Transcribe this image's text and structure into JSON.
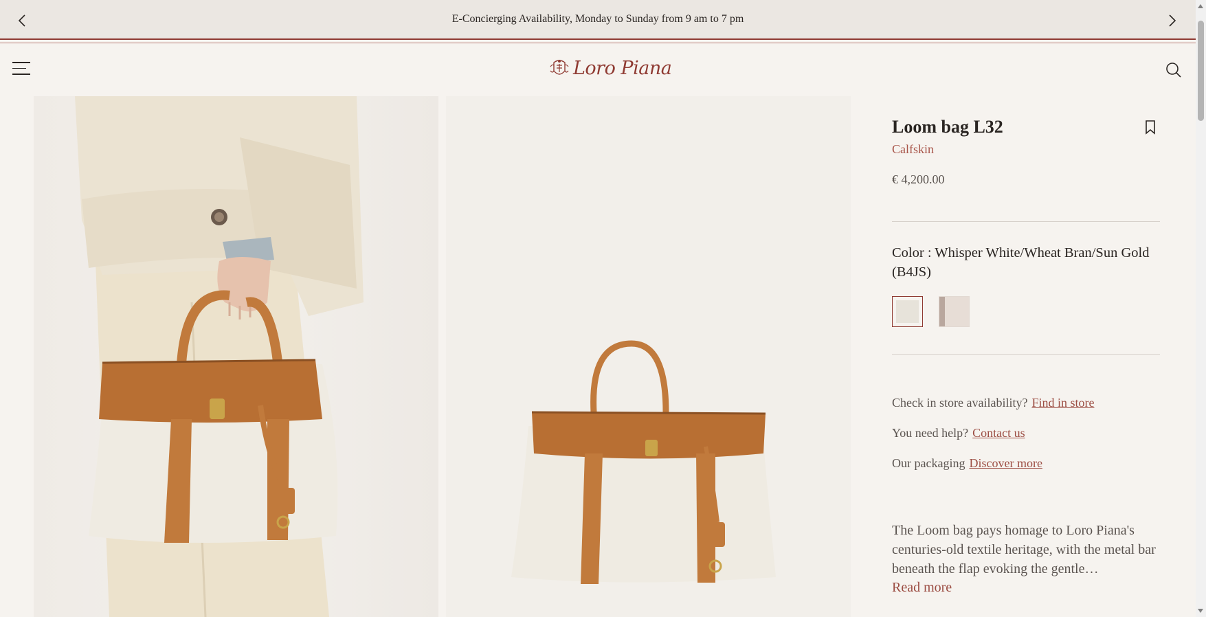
{
  "announcement": {
    "text": "E-Concierging Availability, Monday to Sunday from 9 am to 7 pm",
    "prev_icon": "chevron-left-icon",
    "next_icon": "chevron-right-icon"
  },
  "header": {
    "menu_icon": "hamburger-menu-icon",
    "logo_text": "Loro Piana",
    "search_icon": "search-icon"
  },
  "product": {
    "title": "Loom bag L32",
    "material": "Calfskin",
    "price": "€ 4,200.00",
    "bookmark_icon": "bookmark-icon",
    "color_label": "Color : Whisper White/Wheat Bran/Sun Gold (B4JS)",
    "swatches": [
      {
        "name": "Whisper White/Wheat Bran/Sun Gold",
        "selected": true,
        "color": "#e7e3da"
      },
      {
        "name": "alternate",
        "selected": false,
        "color": "#e7ddd6"
      }
    ]
  },
  "links": {
    "store_prompt": "Check in store availability?",
    "store_link": "Find in store",
    "help_prompt": "You need help?",
    "help_link": "Contact us",
    "packaging_prompt": "Our packaging",
    "packaging_link": "Discover more"
  },
  "description": {
    "text": "The Loom bag pays homage to Loro Piana's centuries-old textile heritage, with the metal bar beneath the flap evoking the gentle…",
    "read_more": "Read more"
  },
  "colors": {
    "accent": "#8f3a32",
    "link": "#9c4d43",
    "leather": "#c17a3c",
    "canvas": "#efebe2"
  }
}
